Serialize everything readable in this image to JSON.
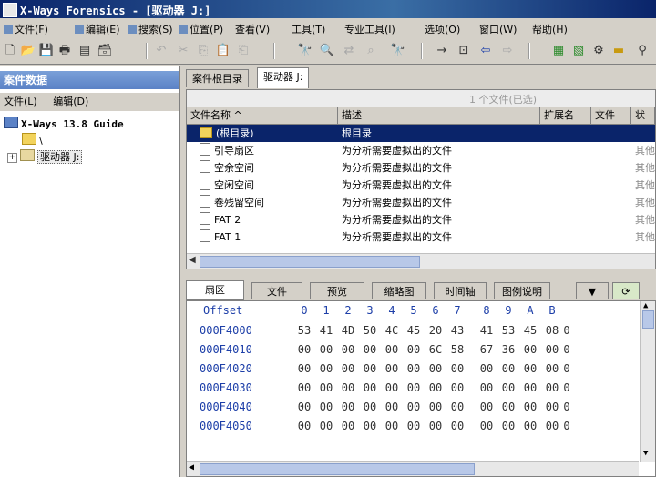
{
  "titlebar": {
    "title": "X-Ways Forensics - [驱动器 J:]"
  },
  "menubar": [
    {
      "label": "文件(F)"
    },
    {
      "label": "编辑(E)"
    },
    {
      "label": "搜索(S)"
    },
    {
      "label": "位置(P)"
    },
    {
      "label": "查看(V)"
    },
    {
      "label": "工具(T)"
    },
    {
      "label": "专业工具(I)"
    },
    {
      "label": "选项(O)"
    },
    {
      "label": "窗口(W)"
    },
    {
      "label": "帮助(H)"
    }
  ],
  "toolbar": {
    "icons": [
      "new-file-icon",
      "open-icon",
      "save-icon",
      "print-icon",
      "properties-icon",
      "case-icon",
      "undo-icon",
      "cut-icon",
      "copy-icon",
      "paste-icon",
      "paste-special-icon",
      "find-icon",
      "find-text-icon",
      "replace-icon",
      "find-hex-icon",
      "find-next-icon",
      "goto-offset-icon",
      "goto-sector-icon",
      "back-icon",
      "forward-icon",
      "calculator-icon",
      "options-icon",
      "tools-icon",
      "disk-icon",
      "search-icon"
    ]
  },
  "left_pane": {
    "title": "案件数据",
    "menu": [
      "文件(L)",
      "编辑(D)"
    ],
    "tree": [
      {
        "label": "X-Ways 13.8 Guide"
      },
      {
        "label": "\\"
      },
      {
        "label": "驱动器 J:"
      }
    ]
  },
  "tabs_top": [
    {
      "label": "案件根目录"
    },
    {
      "label": "驱动器 J:"
    }
  ],
  "file_list": {
    "filter_hint": "1 个文件(已选)",
    "columns": [
      "文件名称 ^",
      "描述",
      "扩展名",
      "文件",
      "状"
    ],
    "rows": [
      {
        "name": "(根目录)",
        "desc": "根目录",
        "ext": "",
        "type": "",
        "selected": true,
        "folder": true
      },
      {
        "name": "引导扇区",
        "desc": "为分析需要虚拟出的文件",
        "ext": "",
        "type": "其他"
      },
      {
        "name": "空余空间",
        "desc": "为分析需要虚拟出的文件",
        "ext": "",
        "type": "其他"
      },
      {
        "name": "空闲空间",
        "desc": "为分析需要虚拟出的文件",
        "ext": "",
        "type": "其他"
      },
      {
        "name": "卷残留空间",
        "desc": "为分析需要虚拟出的文件",
        "ext": "",
        "type": "其他"
      },
      {
        "name": "FAT 2",
        "desc": "为分析需要虚拟出的文件",
        "ext": "",
        "type": "其他"
      },
      {
        "name": "FAT 1",
        "desc": "为分析需要虚拟出的文件",
        "ext": "",
        "type": "其他"
      }
    ]
  },
  "tabs_bottom": [
    {
      "label": "扇区"
    },
    {
      "label": "文件"
    },
    {
      "label": "预览"
    },
    {
      "label": "缩略图"
    },
    {
      "label": "时间轴"
    },
    {
      "label": "图例说明"
    }
  ],
  "hex": {
    "offset_label": "Offset",
    "columns": [
      "0",
      "1",
      "2",
      "3",
      "4",
      "5",
      "6",
      "7",
      "8",
      "9",
      "A",
      "B"
    ],
    "rows": [
      {
        "offset": "000F4000",
        "bytes": [
          "53",
          "41",
          "4D",
          "50",
          "4C",
          "45",
          "20",
          "43",
          "41",
          "53",
          "45",
          "08",
          "0"
        ]
      },
      {
        "offset": "000F4010",
        "bytes": [
          "00",
          "00",
          "00",
          "00",
          "00",
          "00",
          "6C",
          "58",
          "67",
          "36",
          "00",
          "00",
          "0"
        ]
      },
      {
        "offset": "000F4020",
        "bytes": [
          "00",
          "00",
          "00",
          "00",
          "00",
          "00",
          "00",
          "00",
          "00",
          "00",
          "00",
          "00",
          "0"
        ]
      },
      {
        "offset": "000F4030",
        "bytes": [
          "00",
          "00",
          "00",
          "00",
          "00",
          "00",
          "00",
          "00",
          "00",
          "00",
          "00",
          "00",
          "0"
        ]
      },
      {
        "offset": "000F4040",
        "bytes": [
          "00",
          "00",
          "00",
          "00",
          "00",
          "00",
          "00",
          "00",
          "00",
          "00",
          "00",
          "00",
          "0"
        ]
      },
      {
        "offset": "000F4050",
        "bytes": [
          "00",
          "00",
          "00",
          "00",
          "00",
          "00",
          "00",
          "00",
          "00",
          "00",
          "00",
          "00",
          "0"
        ]
      }
    ]
  },
  "colors": {
    "title_bg": "#0a246a",
    "selection": "#0a246a",
    "hex_offset": "#1c3ea8",
    "panel_bg": "#d4d0c8"
  }
}
